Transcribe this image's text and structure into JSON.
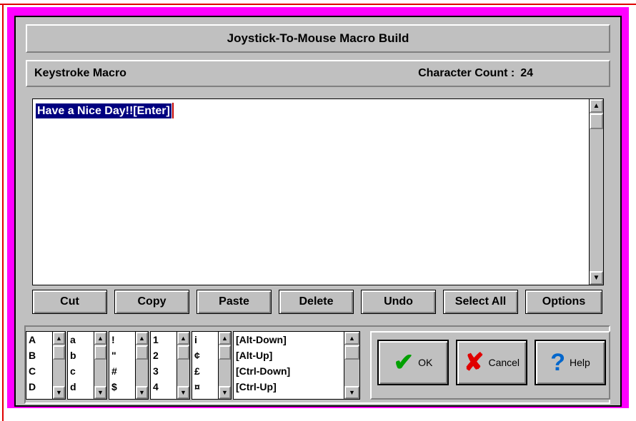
{
  "dialog": {
    "title": "Joystick-To-Mouse Macro Build"
  },
  "header": {
    "label": "Keystroke Macro",
    "char_count_label": "Character Count :",
    "char_count_value": "24"
  },
  "editor": {
    "text": "Have a Nice Day!![Enter]"
  },
  "edit_buttons": {
    "cut": "Cut",
    "copy": "Copy",
    "paste": "Paste",
    "delete": "Delete",
    "undo": "Undo",
    "select_all": "Select All",
    "options": "Options"
  },
  "lists": {
    "upper": [
      "A",
      "B",
      "C",
      "D"
    ],
    "lower": [
      "a",
      "b",
      "c",
      "d"
    ],
    "symbols": [
      "!",
      "\"",
      "#",
      "$"
    ],
    "digits": [
      "1",
      "2",
      "3",
      "4"
    ],
    "extended": [
      "i",
      "¢",
      "£",
      "¤"
    ],
    "special": [
      "[Alt-Down]",
      "[Alt-Up]",
      "[Ctrl-Down]",
      "[Ctrl-Up]"
    ]
  },
  "actions": {
    "ok": "OK",
    "cancel": "Cancel",
    "help": "Help"
  },
  "icons": {
    "ok": "checkmark-icon",
    "cancel": "red-x-icon",
    "help": "question-mark-icon",
    "scroll_up": "arrow-up-icon",
    "scroll_down": "arrow-down-icon"
  },
  "colors": {
    "frame": "#ff00ff",
    "selection": "#000080",
    "check_green": "#00a000",
    "cancel_red": "#e00000",
    "help_blue": "#0066cc"
  }
}
